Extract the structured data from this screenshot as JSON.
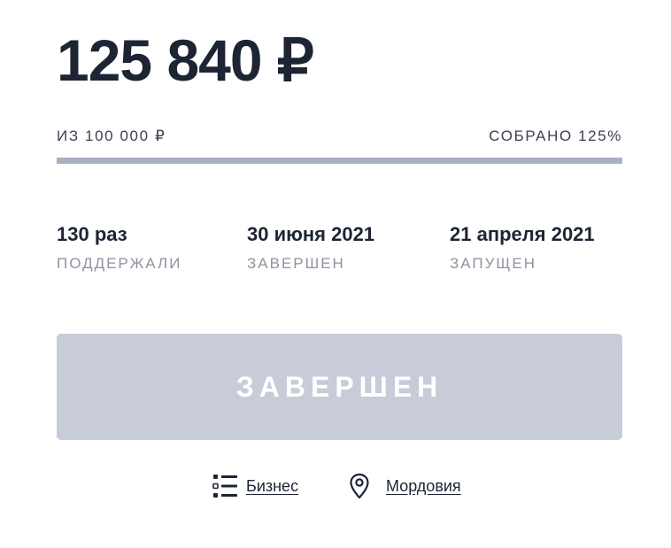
{
  "campaign": {
    "raised": "125 840 ₽",
    "goal_text": "ИЗ 100 000 ₽",
    "collected_text": "СОБРАНО 125%",
    "progress_fraction": 1.0
  },
  "stats": [
    {
      "value": "130 раз",
      "label": "ПОДДЕРЖАЛИ"
    },
    {
      "value": "30 июня 2021",
      "label": "ЗАВЕРШЕН"
    },
    {
      "value": "21 апреля 2021",
      "label": "ЗАПУЩЕН"
    }
  ],
  "status_button": {
    "label": "ЗАВЕРШЕН"
  },
  "tags": {
    "category": {
      "label": "Бизнес",
      "icon": "list-icon"
    },
    "region": {
      "label": "Мордовия",
      "icon": "location-pin-icon"
    }
  },
  "colors": {
    "text_dark": "#1d2434",
    "text_muted": "#8e93a0",
    "progress_fill": "#a9b0c2",
    "button_disabled": "#c7ccd8"
  }
}
